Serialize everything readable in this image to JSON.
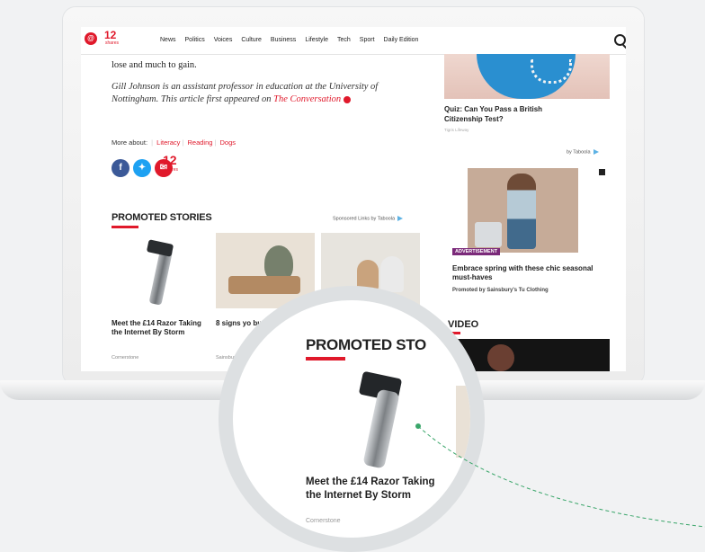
{
  "nav": {
    "logo_count": "12",
    "logo_sub": "shares",
    "links": [
      "News",
      "Politics",
      "Voices",
      "Culture",
      "Business",
      "Lifestyle",
      "Tech",
      "Sport",
      "Daily Edition"
    ]
  },
  "article": {
    "line1": "lose and much to gain.",
    "bio_text": "Gill Johnson is an assistant professor in education at the University of Nottingham. This article first appeared on ",
    "bio_link": "The Conversation",
    "more_about_label": "More about:",
    "tags": [
      "Literacy",
      "Reading",
      "Dogs"
    ],
    "share_count": "12",
    "share_sub": "shares"
  },
  "promoted": {
    "heading": "PROMOTED STORIES",
    "sponsored": "Sponsored Links by Taboola",
    "stories": [
      {
        "title": "Meet the £14 Razor Taking the Internet By Storm",
        "source": "Cornerstone"
      },
      {
        "title": "8 signs yo bumpki",
        "source": "Sainsbur"
      }
    ]
  },
  "sidebar": {
    "quiz_title": "Quiz: Can You Pass a British Citizenship Test?",
    "quiz_source": "Tigris Lifeway",
    "taboola": "by Taboola",
    "ad_badge": "ADVERTISEMENT",
    "ad_title": "Embrace spring with these chic seasonal must-haves",
    "ad_by": "Promoted by Sainsbury's Tu Clothing",
    "video_heading": "VIDEO"
  },
  "magnifier": {
    "heading": "PROMOTED STO",
    "title": "Meet the £14 Razor Taking the Internet By Storm",
    "source": "Cornerstone",
    "side_text": "8"
  },
  "colors": {
    "brand_red": "#e0192b",
    "facebook": "#3b5998",
    "twitter": "#1da1f2",
    "taboola": "#5db2e4",
    "pointer": "#3aa66a"
  },
  "icons": [
    "search-icon",
    "facebook-icon",
    "twitter-icon",
    "email-icon",
    "taboola-icon",
    "adchoices-icon"
  ]
}
